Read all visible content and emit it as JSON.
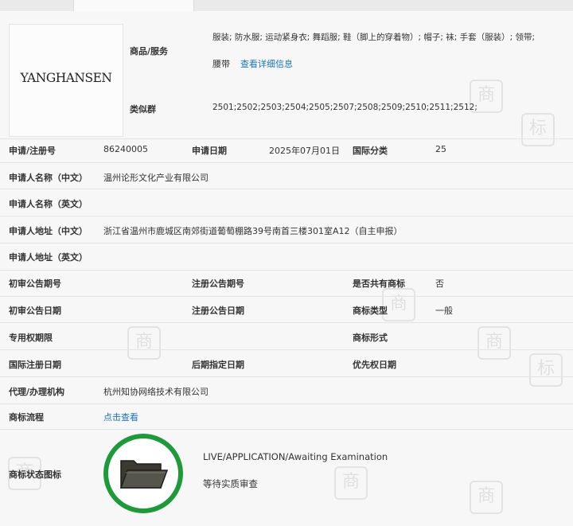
{
  "goods": {
    "label": "商品/服务",
    "line1": "服装; 防水服; 运动紧身衣; 舞蹈服; 鞋（脚上的穿着物）; 帽子; 袜; 手套（服装）; 领带;",
    "line2": "腰带",
    "detail_link": "查看详细信息"
  },
  "similar_groups": {
    "label": "类似群",
    "value": "2501;2502;2503;2504;2505;2507;2508;2509;2510;2511;2512;"
  },
  "logo": {
    "text": "YANGHANSEN"
  },
  "fields": {
    "reg_no_label": "申请/注册号",
    "reg_no": "86240005",
    "apply_date_label": "申请日期",
    "apply_date": "2025年07月01日",
    "intl_class_label": "国际分类",
    "intl_class": "25",
    "applicant_cn_label": "申请人名称（中文）",
    "applicant_cn": "温州论形文化产业有限公司",
    "applicant_en_label": "申请人名称（英文）",
    "address_cn_label": "申请人地址（中文）",
    "address_cn": "浙江省温州市鹿城区南郊街道葡萄棚路39号南首三楼301室A12（自主申报）",
    "address_en_label": "申请人地址（英文）",
    "prelim_no_label": "初审公告期号",
    "reg_notice_no_label": "注册公告期号",
    "shared_label": "是否共有商标",
    "shared": "否",
    "prelim_date_label": "初审公告日期",
    "reg_notice_date_label": "注册公告日期",
    "tm_type_label": "商标类型",
    "tm_type": "一般",
    "exclusive_label": "专用权期限",
    "tm_form_label": "商标形式",
    "intl_reg_date_label": "国际注册日期",
    "later_date_label": "后期指定日期",
    "priority_date_label": "优先权日期",
    "agent_label": "代理/办理机构",
    "agent": "杭州知协网络技术有限公司",
    "flow_label": "商标流程",
    "flow_link": "点击查看",
    "status_icon_label": "商标状态图标",
    "status_en": "LIVE/APPLICATION/Awaiting Examination",
    "status_cn": "等待实质审查"
  },
  "colors": {
    "status_ring": "#1f9a3a",
    "link": "#1a73b8"
  },
  "icons": [
    "folder-icon"
  ]
}
